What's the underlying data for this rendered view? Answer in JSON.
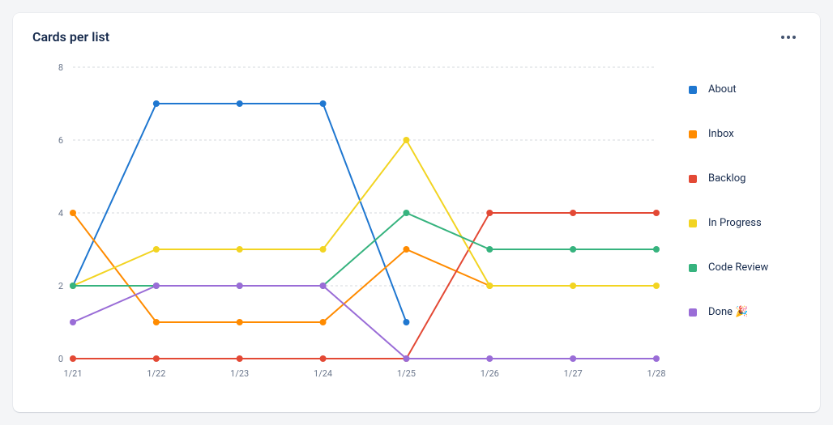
{
  "title": "Cards per list",
  "chart_data": {
    "type": "line",
    "categories": [
      "1/21",
      "1/22",
      "1/23",
      "1/24",
      "1/25",
      "1/26",
      "1/27",
      "1/28"
    ],
    "series": [
      {
        "name": "About",
        "color": "#1f77d0",
        "values": [
          2,
          7,
          7,
          7,
          1,
          null,
          null,
          null
        ]
      },
      {
        "name": "Inbox",
        "color": "#ff8b00",
        "values": [
          4,
          1,
          1,
          1,
          3,
          2,
          null,
          null
        ]
      },
      {
        "name": "Backlog",
        "color": "#e34935",
        "values": [
          0,
          0,
          0,
          0,
          0,
          4,
          4,
          4
        ]
      },
      {
        "name": "In Progress",
        "color": "#f2d422",
        "values": [
          2,
          3,
          3,
          3,
          6,
          2,
          2,
          2
        ]
      },
      {
        "name": "Code Review",
        "color": "#36b37e",
        "values": [
          2,
          2,
          2,
          2,
          4,
          3,
          3,
          3
        ]
      },
      {
        "name": "Done 🎉",
        "color": "#9a6dd7",
        "values": [
          1,
          2,
          2,
          2,
          0,
          0,
          0,
          0
        ]
      }
    ],
    "ylim": [
      0,
      8
    ],
    "yticks": [
      0,
      2,
      4,
      6,
      8
    ],
    "xlabel": "",
    "ylabel": "",
    "title": "Cards per list"
  }
}
